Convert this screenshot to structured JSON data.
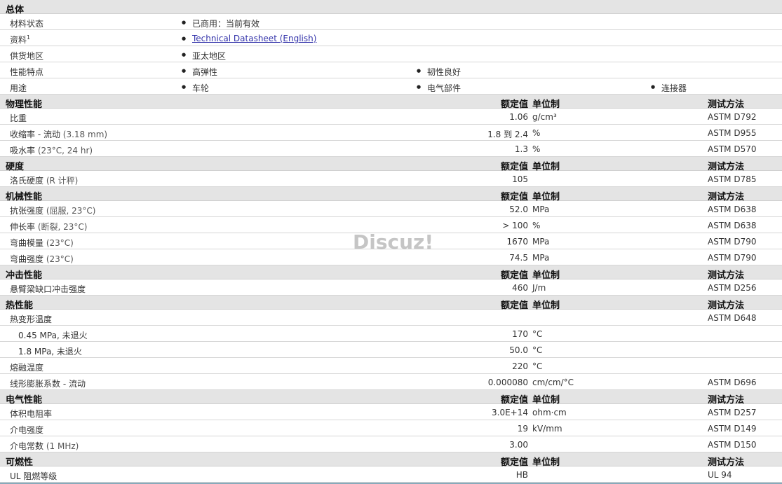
{
  "overview": {
    "title": "总体",
    "rows": [
      {
        "label": "材料状态",
        "items": [
          "已商用：当前有效"
        ]
      },
      {
        "label": "资料",
        "sup": "1",
        "items": [
          "Technical Datasheet (English)"
        ],
        "link": true
      },
      {
        "label": "供货地区",
        "items": [
          "亚太地区"
        ]
      },
      {
        "label": "性能特点",
        "items": [
          "高弹性",
          "韧性良好"
        ]
      },
      {
        "label": "用途",
        "items": [
          "车轮",
          "电气部件",
          "连接器"
        ]
      }
    ]
  },
  "columns": {
    "value": "额定值",
    "unit": "单位制",
    "method": "测试方法"
  },
  "sections": [
    {
      "title": "物理性能",
      "rows": [
        {
          "label": "比重",
          "value": "1.06",
          "unit": "g/cm³",
          "method": "ASTM D792"
        },
        {
          "label": "收缩率 - 流动",
          "paren": "(3.18 mm)",
          "value": "1.8 到  2.4",
          "unit": "%",
          "method": "ASTM D955"
        },
        {
          "label": "吸水率",
          "paren": "(23°C, 24 hr)",
          "value": "1.3",
          "unit": "%",
          "method": "ASTM D570"
        }
      ]
    },
    {
      "title": "硬度",
      "rows": [
        {
          "label": "洛氏硬度",
          "paren": "(R 计秤)",
          "value": "105",
          "unit": "",
          "method": "ASTM D785"
        }
      ]
    },
    {
      "title": "机械性能",
      "rows": [
        {
          "label": "抗张强度",
          "paren": "(屈服, 23°C)",
          "value": "52.0",
          "unit": "MPa",
          "method": "ASTM D638"
        },
        {
          "label": "伸长率",
          "paren": "(断裂, 23°C)",
          "value": "> 100",
          "unit": "%",
          "method": "ASTM D638"
        },
        {
          "label": "弯曲模量",
          "paren": "(23°C)",
          "value": "1670",
          "unit": "MPa",
          "method": "ASTM D790"
        },
        {
          "label": "弯曲强度",
          "paren": "(23°C)",
          "value": "74.5",
          "unit": "MPa",
          "method": "ASTM D790"
        }
      ]
    },
    {
      "title": "冲击性能",
      "rows": [
        {
          "label": "悬臂梁缺口冲击强度",
          "value": "460",
          "unit": "J/m",
          "method": "ASTM D256"
        }
      ]
    },
    {
      "title": "热性能",
      "rows": [
        {
          "label": "热变形温度",
          "value": "",
          "unit": "",
          "method": "ASTM D648"
        },
        {
          "label": "0.45 MPa, 未退火",
          "indent": true,
          "value": "170",
          "unit": "°C",
          "method": ""
        },
        {
          "label": "1.8 MPa, 未退火",
          "indent": true,
          "value": "50.0",
          "unit": "°C",
          "method": ""
        },
        {
          "label": "熔融温度",
          "value": "220",
          "unit": "°C",
          "method": ""
        },
        {
          "label": "线形膨胀系数 - 流动",
          "value": "0.000080",
          "unit": "cm/cm/°C",
          "method": "ASTM D696"
        }
      ]
    },
    {
      "title": "电气性能",
      "rows": [
        {
          "label": "体积电阻率",
          "value": "3.0E+14",
          "unit": "ohm·cm",
          "method": "ASTM D257"
        },
        {
          "label": "介电强度",
          "value": "19",
          "unit": "kV/mm",
          "method": "ASTM D149"
        },
        {
          "label": "介电常数",
          "paren": "(1 MHz)",
          "value": "3.00",
          "unit": "",
          "method": "ASTM D150"
        }
      ]
    },
    {
      "title": "可燃性",
      "rows": [
        {
          "label": "UL 阻燃等级",
          "value": "HB",
          "unit": "",
          "method": "UL 94"
        }
      ]
    }
  ],
  "watermark": "Discuz!"
}
